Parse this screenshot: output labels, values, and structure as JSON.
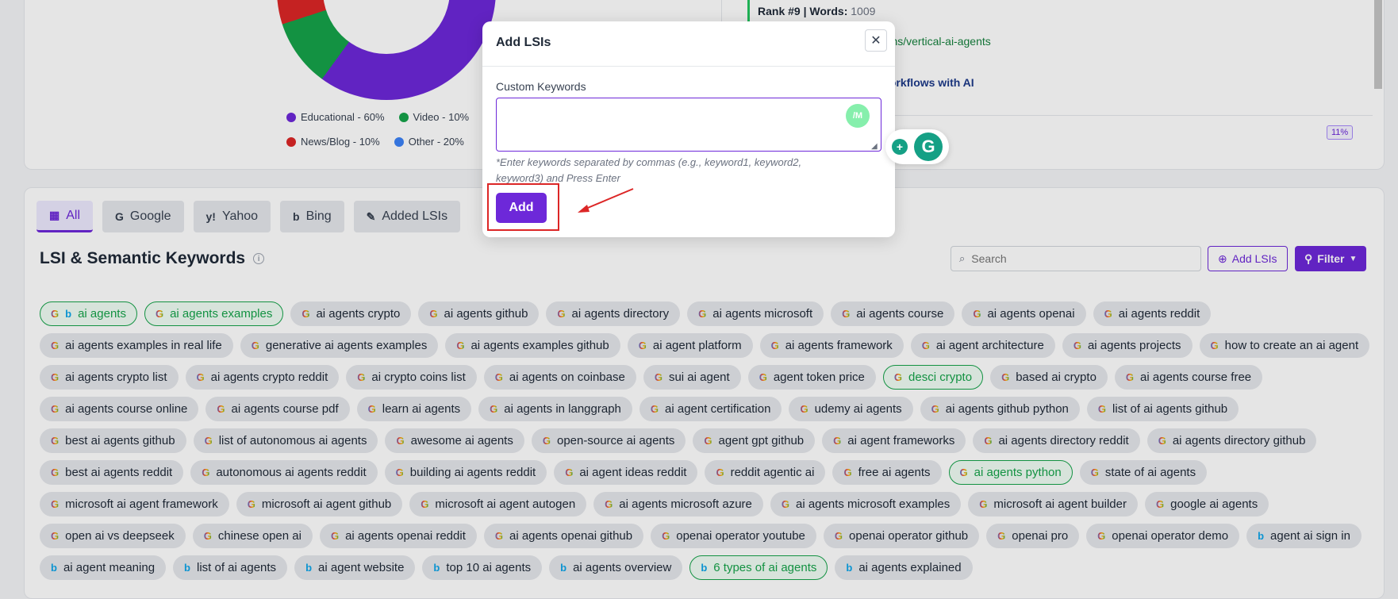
{
  "chart_data": {
    "type": "pie",
    "slices": [
      {
        "label": "Educational - 60%",
        "value": 60,
        "color": "#6d28d9"
      },
      {
        "label": "Video - 10%",
        "value": 10,
        "color": "#16a34a"
      },
      {
        "label": "News/Blog - 10%",
        "value": 10,
        "color": "#dc2626"
      },
      {
        "label": "Other - 20%",
        "value": 20,
        "color": "#3b82f6"
      }
    ]
  },
  "results": {
    "rank_label": "Rank #9 | Words:",
    "rank_words": "1009",
    "url": "olutions/vertical-ai-agents",
    "title": "ur Workflows with AI",
    "percent": "11%"
  },
  "tabs": [
    {
      "label": "All",
      "icon": "grid-icon",
      "active": true
    },
    {
      "label": "Google",
      "icon": "google-icon"
    },
    {
      "label": "Yahoo",
      "icon": "yahoo-icon"
    },
    {
      "label": "Bing",
      "icon": "bing-icon"
    },
    {
      "label": "Added LSIs",
      "icon": "pencil-icon"
    }
  ],
  "section_title": "LSI & Semantic Keywords",
  "search": {
    "placeholder": "Search"
  },
  "add_lsis_label": "Add LSIs",
  "filter_label": "Filter",
  "keywords": [
    {
      "text": "ai agents",
      "hl": true,
      "src": "gb"
    },
    {
      "text": "ai agents examples",
      "hl": true,
      "src": "g"
    },
    {
      "text": "ai agents crypto",
      "src": "g"
    },
    {
      "text": "ai agents github",
      "src": "g"
    },
    {
      "text": "ai agents directory",
      "src": "g"
    },
    {
      "text": "ai agents microsoft",
      "src": "g"
    },
    {
      "text": "ai agents course",
      "src": "g"
    },
    {
      "text": "ai agents openai",
      "src": "g"
    },
    {
      "text": "ai agents reddit",
      "src": "g"
    },
    {
      "text": "ai agents examples in real life",
      "src": "g"
    },
    {
      "text": "generative ai agents examples",
      "src": "g"
    },
    {
      "text": "ai agents examples github",
      "src": "g"
    },
    {
      "text": "ai agent platform",
      "src": "g"
    },
    {
      "text": "ai agents framework",
      "src": "g"
    },
    {
      "text": "ai agent architecture",
      "src": "g"
    },
    {
      "text": "ai agents projects",
      "src": "g"
    },
    {
      "text": "how to create an ai agent",
      "src": "g"
    },
    {
      "text": "ai agents crypto list",
      "src": "g"
    },
    {
      "text": "ai agents crypto reddit",
      "src": "g"
    },
    {
      "text": "ai crypto coins list",
      "src": "g"
    },
    {
      "text": "ai agents on coinbase",
      "src": "g"
    },
    {
      "text": "sui ai agent",
      "src": "g"
    },
    {
      "text": "agent token price",
      "src": "g"
    },
    {
      "text": "desci crypto",
      "hl": true,
      "src": "g"
    },
    {
      "text": "based ai crypto",
      "src": "g"
    },
    {
      "text": "ai agents course free",
      "src": "g"
    },
    {
      "text": "ai agents course online",
      "src": "g"
    },
    {
      "text": "ai agents course pdf",
      "src": "g"
    },
    {
      "text": "learn ai agents",
      "src": "g"
    },
    {
      "text": "ai agents in langgraph",
      "src": "g"
    },
    {
      "text": "ai agent certification",
      "src": "g"
    },
    {
      "text": "udemy ai agents",
      "src": "g"
    },
    {
      "text": "ai agents github python",
      "src": "g"
    },
    {
      "text": "list of ai agents github",
      "src": "g"
    },
    {
      "text": "best ai agents github",
      "src": "g"
    },
    {
      "text": "list of autonomous ai agents",
      "src": "g"
    },
    {
      "text": "awesome ai agents",
      "src": "g"
    },
    {
      "text": "open-source ai agents",
      "src": "g"
    },
    {
      "text": "agent gpt github",
      "src": "g"
    },
    {
      "text": "ai agent frameworks",
      "src": "g"
    },
    {
      "text": "ai agents directory reddit",
      "src": "g"
    },
    {
      "text": "ai agents directory github",
      "src": "g"
    },
    {
      "text": "best ai agents reddit",
      "src": "g"
    },
    {
      "text": "autonomous ai agents reddit",
      "src": "g"
    },
    {
      "text": "building ai agents reddit",
      "src": "g"
    },
    {
      "text": "ai agent ideas reddit",
      "src": "g"
    },
    {
      "text": "reddit agentic ai",
      "src": "g"
    },
    {
      "text": "free ai agents",
      "src": "g"
    },
    {
      "text": "ai agents python",
      "hl": true,
      "src": "g"
    },
    {
      "text": "state of ai agents",
      "src": "g"
    },
    {
      "text": "microsoft ai agent framework",
      "src": "g"
    },
    {
      "text": "microsoft ai agent github",
      "src": "g"
    },
    {
      "text": "microsoft ai agent autogen",
      "src": "g"
    },
    {
      "text": "ai agents microsoft azure",
      "src": "g"
    },
    {
      "text": "ai agents microsoft examples",
      "src": "g"
    },
    {
      "text": "microsoft ai agent builder",
      "src": "g"
    },
    {
      "text": "google ai agents",
      "src": "g"
    },
    {
      "text": "open ai vs deepseek",
      "src": "g"
    },
    {
      "text": "chinese open ai",
      "src": "g"
    },
    {
      "text": "ai agents openai reddit",
      "src": "g"
    },
    {
      "text": "ai agents openai github",
      "src": "g"
    },
    {
      "text": "openai operator youtube",
      "src": "g"
    },
    {
      "text": "openai operator github",
      "src": "g"
    },
    {
      "text": "openai pro",
      "src": "g"
    },
    {
      "text": "openai operator demo",
      "src": "g"
    },
    {
      "text": "agent ai sign in",
      "src": "b"
    },
    {
      "text": "ai agent meaning",
      "src": "b"
    },
    {
      "text": "list of ai agents",
      "src": "b"
    },
    {
      "text": "ai agent website",
      "src": "b"
    },
    {
      "text": "top 10 ai agents",
      "src": "b"
    },
    {
      "text": "ai agents overview",
      "src": "b"
    },
    {
      "text": "6 types of ai agents",
      "hl": true,
      "src": "b"
    },
    {
      "text": "ai agents explained",
      "src": "b"
    }
  ],
  "modal": {
    "title": "Add LSIs",
    "label": "Custom Keywords",
    "textarea_value": "",
    "avatar": "/M",
    "hint": "*Enter keywords separated by commas (e.g., keyword1, keyword2, keyword3) and Press Enter",
    "add_label": "Add"
  }
}
